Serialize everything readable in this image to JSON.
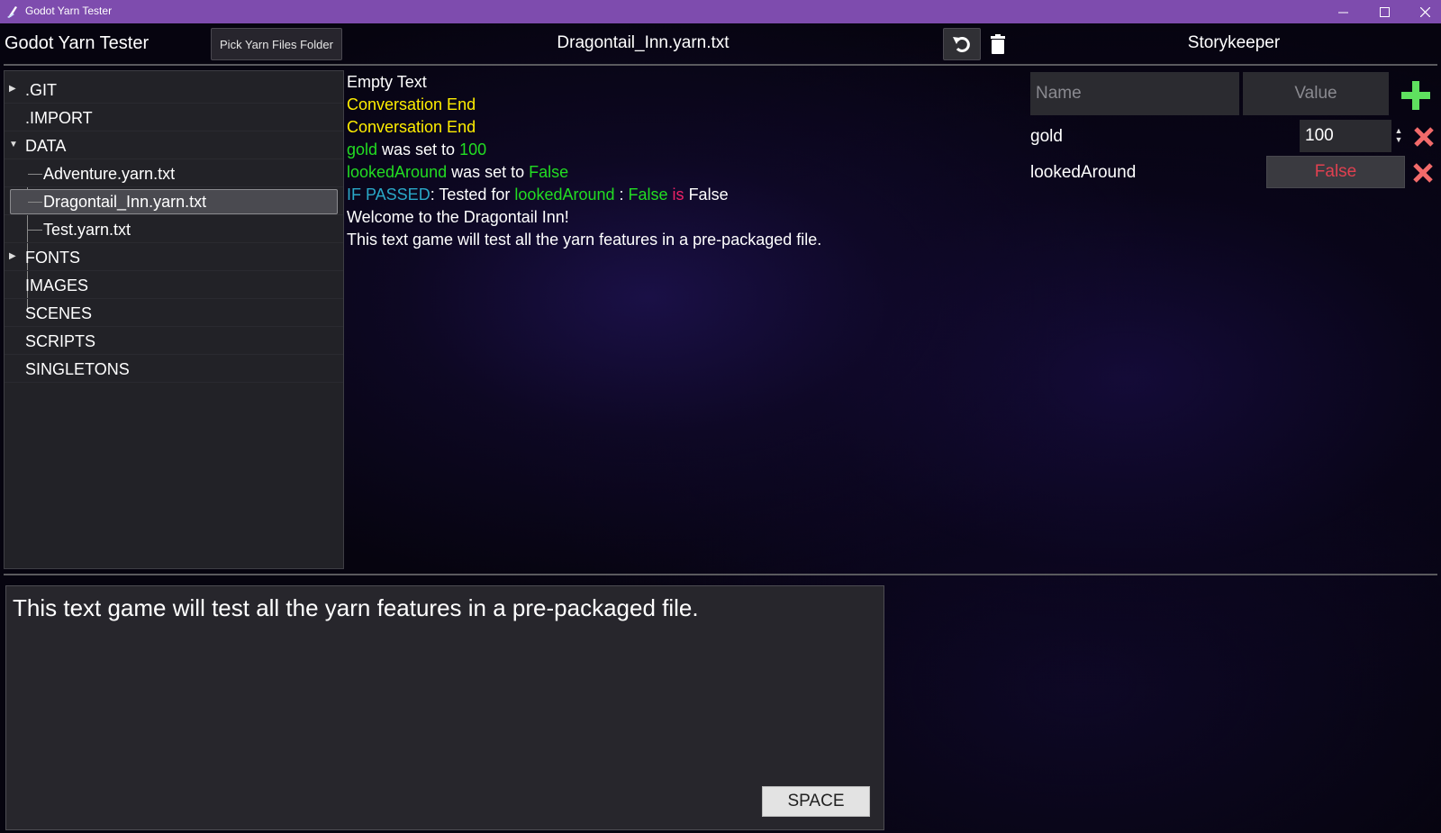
{
  "window": {
    "title": "Godot Yarn Tester",
    "controls": [
      "minimize",
      "maximize",
      "close"
    ]
  },
  "toolbar": {
    "app_title": "Godot Yarn Tester",
    "pick_button": "Pick Yarn Files Folder",
    "current_file": "Dragontail_Inn.yarn.txt",
    "storykeeper_title": "Storykeeper"
  },
  "file_tree": {
    "items": [
      {
        "label": ".GIT",
        "expander": "collapsed"
      },
      {
        "label": ".IMPORT"
      },
      {
        "label": "DATA",
        "expander": "expanded"
      },
      {
        "label": "Adventure.yarn.txt"
      },
      {
        "label": "Dragontail_Inn.yarn.txt",
        "selected": true
      },
      {
        "label": "Test.yarn.txt"
      },
      {
        "label": "FONTS",
        "expander": "collapsed"
      },
      {
        "label": "IMAGES"
      },
      {
        "label": "SCENES"
      },
      {
        "label": "SCRIPTS"
      },
      {
        "label": "SINGLETONS"
      }
    ]
  },
  "log": {
    "line1": "Empty Text",
    "line2": "Conversation End",
    "line3": "Conversation End",
    "line4": {
      "var": "gold",
      "mid": " was set to ",
      "val": "100"
    },
    "line5": {
      "var": "lookedAround",
      "mid": " was set to ",
      "val": "False"
    },
    "line6": {
      "tag": "IF PASSED",
      "mid": ": Tested for ",
      "var": "lookedAround",
      "sep": " : ",
      "val": "False",
      "op": " is ",
      "rhs": "False"
    },
    "line7": "Welcome to the Dragontail Inn!",
    "line8": "This text game will test all the yarn features in a pre-packaged file."
  },
  "storykeeper": {
    "name_placeholder": "Name",
    "value_placeholder": "Value",
    "variables": [
      {
        "name": "gold",
        "value": "100"
      },
      {
        "name": "lookedAround",
        "value": "False"
      }
    ]
  },
  "dialogue": {
    "text": "This text game will test all the yarn features in a pre-packaged file.",
    "continue_button": "SPACE"
  },
  "colors": {
    "titlebar": "#7e4cae",
    "yellow": "#ffee00",
    "green": "#22dd22",
    "cyan": "#2aa8c8",
    "pink": "#ee2266",
    "delete_red": "#f26a6a",
    "add_green": "#5fe05f"
  }
}
